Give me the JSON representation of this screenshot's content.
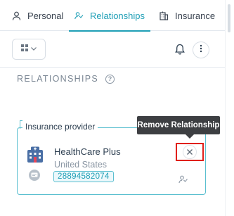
{
  "tabs": [
    {
      "label": "Personal",
      "icon": "person-icon",
      "active": false
    },
    {
      "label": "Relationships",
      "icon": "relationships-icon",
      "active": true
    },
    {
      "label": "Insurance",
      "icon": "building-icon",
      "active": false
    }
  ],
  "toolbar": {
    "view_icon": "grid-view-icon",
    "notification_icon": "bell-icon",
    "more_icon": "more-vertical-icon"
  },
  "section": {
    "title": "RELATIONSHIPS",
    "help_glyph": "?"
  },
  "relationship_card": {
    "legend": "Insurance provider",
    "name": "HealthCare Plus",
    "country": "United States",
    "id": "28894582074"
  },
  "tooltip": {
    "text": "Remove Relationship"
  },
  "colors": {
    "accent": "#1f9fb6",
    "border_accent": "#5bbfd0",
    "highlight": "#e0201b",
    "tooltip_bg": "#3d3f42",
    "muted_text": "#7b8794"
  }
}
